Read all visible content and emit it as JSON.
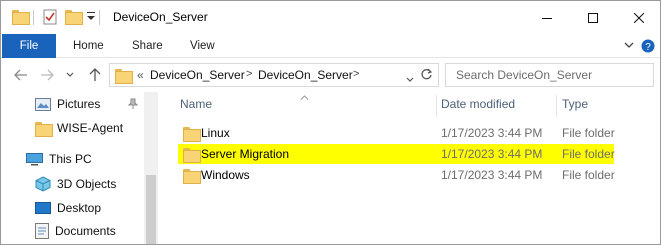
{
  "window": {
    "title": "DeviceOn_Server",
    "minimize_glyph": "—",
    "maximize_glyph": "☐",
    "close_glyph": "✕"
  },
  "ribbon": {
    "tabs": [
      "File",
      "Home",
      "Share",
      "View"
    ]
  },
  "address": {
    "overflow": "«",
    "crumbs": [
      "DeviceOn_Server",
      "DeviceOn_Server"
    ],
    "separator": ">"
  },
  "search": {
    "placeholder": "Search DeviceOn_Server"
  },
  "navpane": {
    "items": [
      {
        "label": "Pictures",
        "icon": "pictures-icon",
        "pinned": true
      },
      {
        "label": "WISE-Agent",
        "icon": "folder-icon"
      },
      {
        "label": "This PC",
        "icon": "computer-icon"
      },
      {
        "label": "3D Objects",
        "icon": "3d-objects-icon"
      },
      {
        "label": "Desktop",
        "icon": "desktop-icon"
      },
      {
        "label": "Documents",
        "icon": "documents-icon"
      }
    ]
  },
  "columns": {
    "name": "Name",
    "date_modified": "Date modified",
    "type": "Type"
  },
  "files": [
    {
      "name": "Linux",
      "date": "1/17/2023 3:44 PM",
      "type": "File folder",
      "highlighted": false
    },
    {
      "name": "Server Migration",
      "date": "1/17/2023 3:44 PM",
      "type": "File folder",
      "highlighted": true
    },
    {
      "name": "Windows",
      "date": "1/17/2023 3:44 PM",
      "type": "File folder",
      "highlighted": false
    }
  ],
  "colors": {
    "file_tab": "#1a63bd",
    "highlight": "#ffff00",
    "header_text": "#4c607a",
    "folder": "#f8d477"
  }
}
